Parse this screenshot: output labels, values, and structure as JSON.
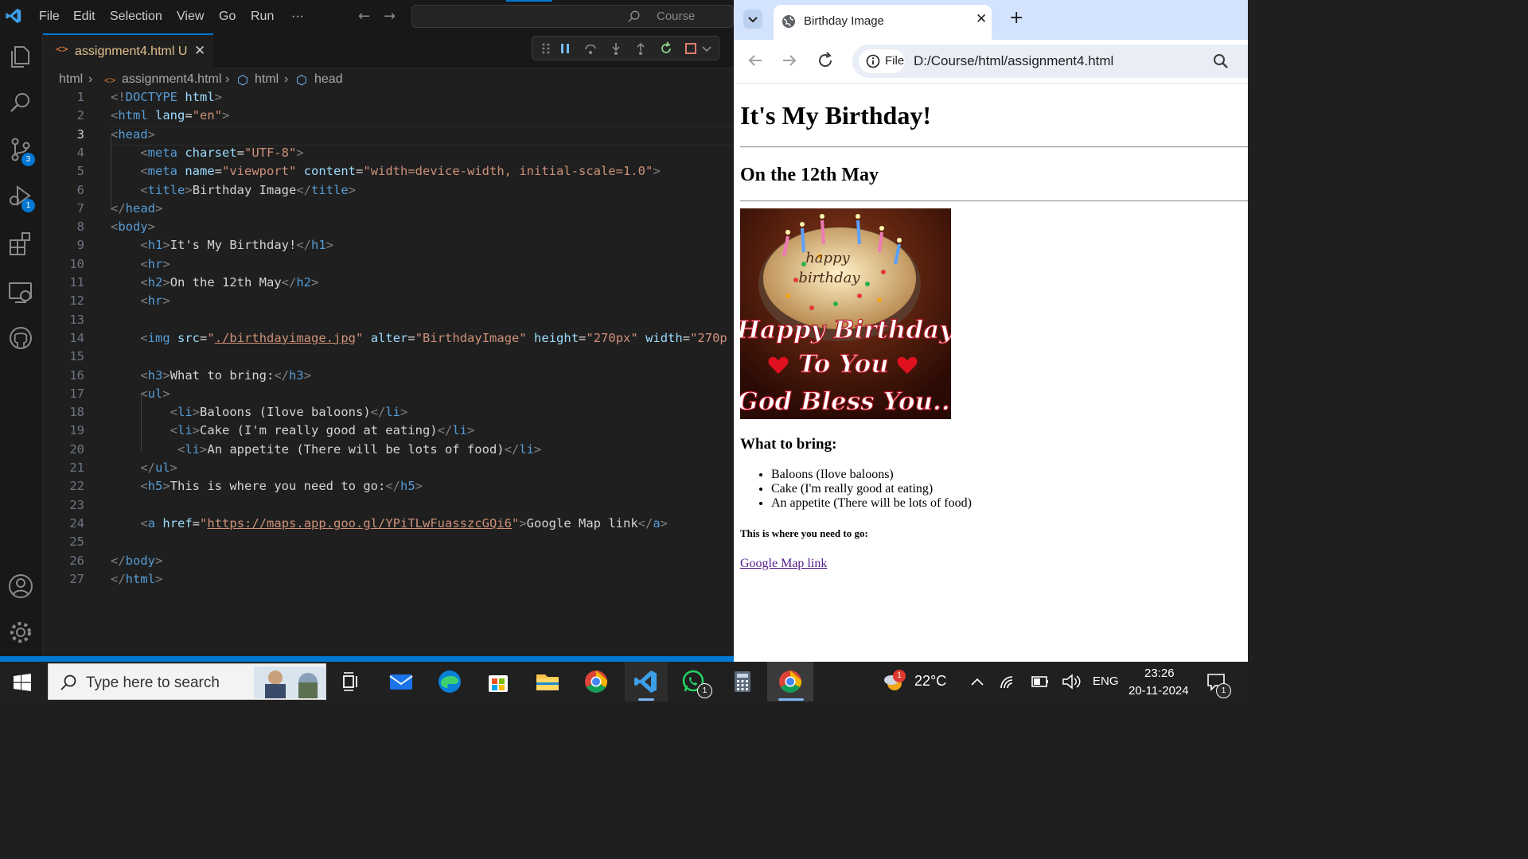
{
  "vscode": {
    "menu": [
      "File",
      "Edit",
      "Selection",
      "View",
      "Go",
      "Run",
      "···"
    ],
    "command_center": "Course",
    "badges": {
      "source_control": "3",
      "run_debug": "1"
    },
    "tab": {
      "title": "assignment4.html",
      "status": "U"
    },
    "breadcrumb": [
      "html",
      "assignment4.html",
      "html",
      "head"
    ],
    "current_line": 3
  },
  "code": [
    "<!DOCTYPE html>",
    "<html lang=\"en\">",
    "<head>",
    "    <meta charset=\"UTF-8\">",
    "    <meta name=\"viewport\" content=\"width=device-width, initial-scale=1.0\">",
    "    <title>Birthday Image</title>",
    "</head>",
    "<body>",
    "    <h1>It's My Birthday!</h1>",
    "    <hr>",
    "    <h2>On the 12th May</h2>",
    "    <hr>",
    "",
    "    <img src=\"./birthdayimage.jpg\" alter=\"BirthdayImage\" height=\"270px\" width=\"270p",
    "",
    "    <h3>What to bring:</h3>",
    "    <ul>",
    "        <li>Baloons (Ilove baloons)</li>",
    "        <li>Cake (I'm really good at eating)</li>",
    "         <li>An appetite (There will be lots of food)</li>",
    "    </ul>",
    "    <h5>This is where you need to go:</h5>",
    "",
    "    <a href=\"https://maps.app.goo.gl/YPiTLwFuasszcGQi6\">Google Map link</a>",
    "",
    "</body>",
    "</html>"
  ],
  "browser": {
    "tab_title": "Birthday Image",
    "chip_label": "File",
    "url": "D:/Course/html/assignment4.html",
    "page": {
      "h1": "It's My Birthday!",
      "h2": "On the 12th May",
      "image_text": [
        "Happy Birthday",
        "To You",
        "God Bless You.."
      ],
      "cake_text": [
        "happy",
        "birthday"
      ],
      "h3": "What to bring:",
      "items": [
        "Baloons (Ilove baloons)",
        "Cake (I'm really good at eating)",
        "An appetite (There will be lots of food)"
      ],
      "h5": "This is where you need to go:",
      "link": "Google Map link"
    }
  },
  "taskbar": {
    "search_placeholder": "Type here to search",
    "whatsapp_badge": "1",
    "weather_badge": "1",
    "temperature": "22°C",
    "language": "ENG",
    "time": "23:26",
    "date": "20-11-2024",
    "notification_count": "1"
  },
  "colors": {
    "accent": "#0078d4",
    "tag": "#569cd6",
    "attr_name": "#9cdcfe",
    "attr_value": "#ce9178",
    "link_visited": "#551a8b"
  }
}
